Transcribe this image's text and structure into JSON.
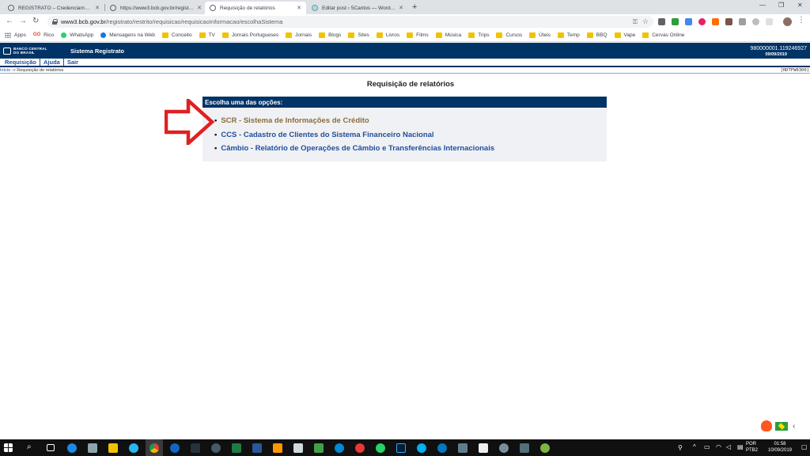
{
  "browser": {
    "tabs": [
      {
        "title": "REGISTRATO – Credenciamento e..."
      },
      {
        "title": "https://www3.bcb.gov.br/registrat..."
      },
      {
        "title": "Requisição de relatórios"
      },
      {
        "title": "Editar post ‹ 5Cantos — WordPr..."
      }
    ],
    "url_host": "www3.bcb.gov.br",
    "url_path": "/registrato/restrito/requisicao/requisicaoInformacao/escolhaSistema",
    "bookmarks": [
      {
        "label": "Apps",
        "icon": "apps-grid-icon"
      },
      {
        "label": "Rico",
        "icon": "rico-icon"
      },
      {
        "label": "WhatsApp",
        "icon": "whatsapp-icon"
      },
      {
        "label": "Mensagens na Web",
        "icon": "messages-icon"
      },
      {
        "label": "Conceito",
        "icon": "folder-icon"
      },
      {
        "label": "TV",
        "icon": "folder-icon"
      },
      {
        "label": "Jornais Portugueses",
        "icon": "folder-icon"
      },
      {
        "label": "Jornais",
        "icon": "folder-icon"
      },
      {
        "label": "Blogs",
        "icon": "folder-icon"
      },
      {
        "label": "Sites",
        "icon": "folder-icon"
      },
      {
        "label": "Livros",
        "icon": "folder-icon"
      },
      {
        "label": "Films",
        "icon": "folder-icon"
      },
      {
        "label": "Música",
        "icon": "folder-icon"
      },
      {
        "label": "Trips",
        "icon": "folder-icon"
      },
      {
        "label": "Cursos",
        "icon": "folder-icon"
      },
      {
        "label": "Úteis",
        "icon": "folder-icon"
      },
      {
        "label": "Temp",
        "icon": "folder-icon"
      },
      {
        "label": "BBQ",
        "icon": "folder-icon"
      },
      {
        "label": "Vape",
        "icon": "folder-icon"
      },
      {
        "label": "Cervas Online",
        "icon": "folder-icon"
      }
    ]
  },
  "site": {
    "logo_line1": "BANCO CENTRAL",
    "logo_line2": "DO BRASIL",
    "system_title": "Sistema Registrato",
    "user_id": "980000001.119246927",
    "user_date": "09/09/2019",
    "menu": {
      "requisicao": "Requisição",
      "ajuda": "Ajuda",
      "sair": "Sair"
    },
    "breadcrumb_home": "Início",
    "breadcrumb_sep": " -> ",
    "breadcrumb_current": "Requisição de relatórios",
    "page_code": "[HDTFW0300]"
  },
  "main": {
    "heading": "Requisição de relatórios",
    "options_header": "Escolha uma das opções:",
    "options": [
      {
        "label": "SCR - Sistema de Informações de Crédito",
        "visited": true
      },
      {
        "label": "CCS - Cadastro de Clientes do Sistema Financeiro Nacional",
        "visited": false
      },
      {
        "label": "Câmbio - Relatório de Operações de Câmbio e Transferências Internacionais",
        "visited": false
      }
    ],
    "arrow_color": "#e02020"
  },
  "taskbar": {
    "lang_line1": "POR",
    "lang_line2": "PTB2",
    "time": "01:58",
    "date": "10/09/2019"
  },
  "colors": {
    "bcb_blue": "#003366",
    "link_blue": "#1f4e9c",
    "visited_link": "#8a6d3b"
  }
}
